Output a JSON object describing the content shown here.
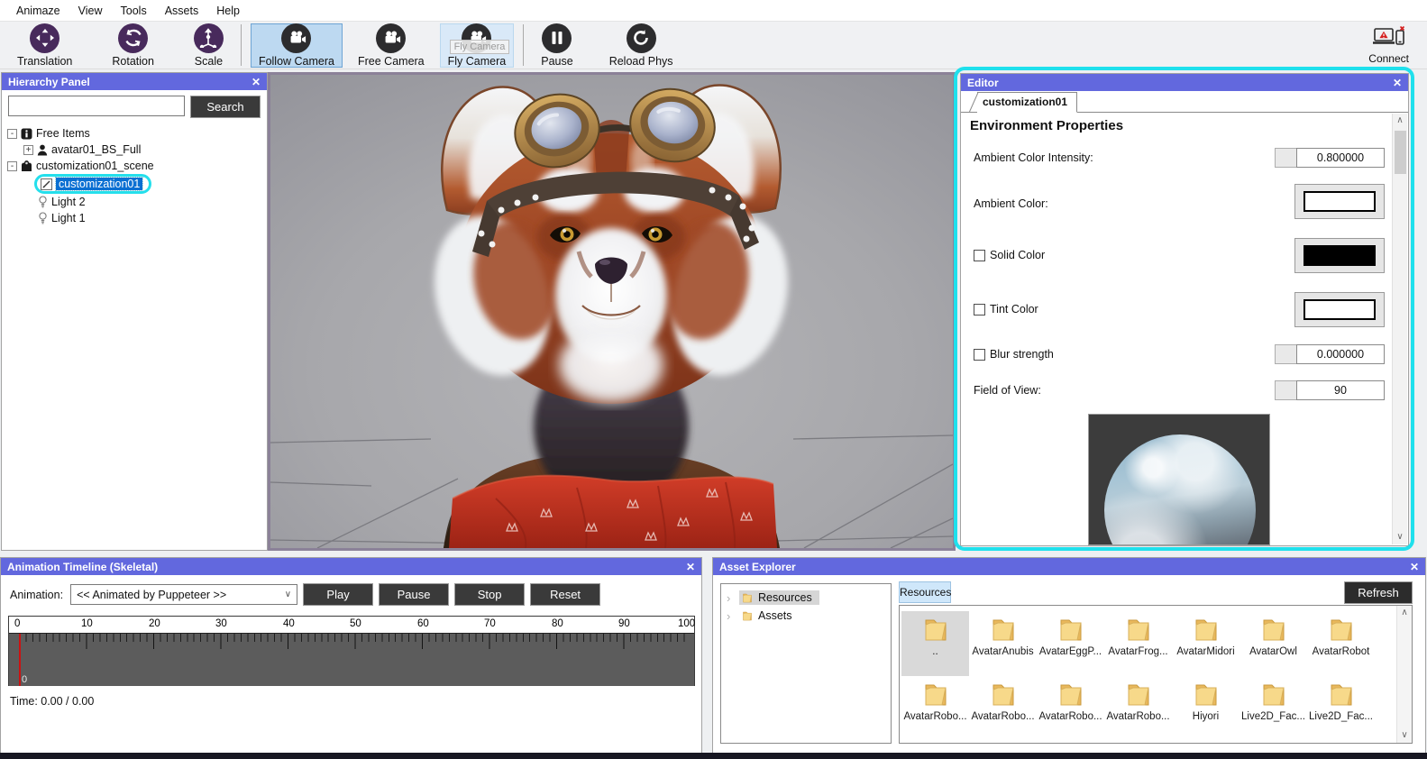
{
  "colors": {
    "titlebar": "#6268de",
    "highlight_cyan": "#1fe0ec",
    "selection_blue": "#0a6fd2",
    "tool_purple": "#482a5c",
    "tool_dark": "#2c2c2e",
    "dark_button": "#3a3a3a",
    "resources_tab_blue": "#cfe7fa",
    "folder_yellow": "#f0c36a",
    "playhead_red": "#cc1111"
  },
  "icons": {
    "close": "✕",
    "caret_down": "∨",
    "scroll_up": "∧",
    "scroll_down": "∨",
    "chevron_right": "›",
    "expand_open": "-",
    "expand_closed": "+"
  },
  "menu": {
    "items": [
      {
        "label": "Animaze"
      },
      {
        "label": "View"
      },
      {
        "label": "Tools"
      },
      {
        "label": "Assets"
      },
      {
        "label": "Help"
      }
    ]
  },
  "toolbar": {
    "tools": [
      {
        "label": "Translation"
      },
      {
        "label": "Rotation"
      },
      {
        "label": "Scale"
      },
      {
        "label": "Follow Camera"
      },
      {
        "label": "Free Camera"
      },
      {
        "label": "Fly Camera"
      },
      {
        "label": "Pause"
      },
      {
        "label": "Reload Phys"
      }
    ],
    "tooltip": "Fly Camera",
    "connect": {
      "label": "Connect"
    }
  },
  "hierarchy": {
    "title": "Hierarchy Panel",
    "search_button": "Search",
    "search_value": "",
    "items": [
      {
        "label": "Free Items"
      },
      {
        "label": "avatar01_BS_Full"
      },
      {
        "label": "customization01_scene"
      },
      {
        "label": "customization01",
        "selected": true
      },
      {
        "label": "Light 2"
      },
      {
        "label": "Light 1"
      }
    ]
  },
  "editor": {
    "title": "Editor",
    "tab": "customization01",
    "heading": "Environment Properties",
    "fields": [
      {
        "label": "Ambient Color Intensity:",
        "value": "0.800000"
      },
      {
        "label": "Ambient Color:",
        "swatch": "#ffffff"
      },
      {
        "label": "Solid Color",
        "checked": false,
        "swatch": "#000000"
      },
      {
        "label": "Tint Color",
        "checked": false,
        "swatch": "#ffffff"
      },
      {
        "label": "Blur strength",
        "checked": false,
        "value": "0.000000"
      },
      {
        "label": "Field of View:",
        "value": "90"
      }
    ]
  },
  "timeline": {
    "title": "Animation Timeline (Skeletal)",
    "animation_label": "Animation:",
    "animation_value": "<< Animated by Puppeteer >>",
    "buttons": [
      {
        "label": "Play"
      },
      {
        "label": "Pause"
      },
      {
        "label": "Stop"
      },
      {
        "label": "Reset"
      }
    ],
    "ruler_labels": [
      "0",
      "10",
      "20",
      "30",
      "40",
      "50",
      "60",
      "70",
      "80",
      "90",
      "100"
    ],
    "playhead_label": "0",
    "time_text": "Time: 0.00 / 0.00"
  },
  "assets": {
    "title": "Asset Explorer",
    "tree": [
      {
        "label": "Resources",
        "selected": true
      },
      {
        "label": "Assets"
      }
    ],
    "tab": "Resources",
    "refresh_label": "Refresh",
    "folders_row1": [
      {
        "label": ".."
      },
      {
        "label": "AvatarAnubis"
      },
      {
        "label": "AvatarEggP..."
      },
      {
        "label": "AvatarFrog..."
      },
      {
        "label": "AvatarMidori"
      },
      {
        "label": "AvatarOwl"
      },
      {
        "label": "AvatarRobot"
      }
    ],
    "folders_row2": [
      {
        "label": "AvatarRobo..."
      },
      {
        "label": "AvatarRobo..."
      },
      {
        "label": "AvatarRobo..."
      },
      {
        "label": "AvatarRobo..."
      },
      {
        "label": "Hiyori"
      },
      {
        "label": "Live2D_Fac..."
      },
      {
        "label": "Live2D_Fac..."
      }
    ]
  }
}
